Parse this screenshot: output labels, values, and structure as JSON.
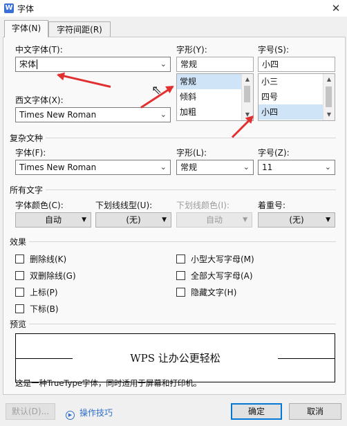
{
  "window": {
    "title": "字体",
    "app_icon": "W",
    "close": "✕"
  },
  "tabs": [
    {
      "label": "字体(N)",
      "active": true
    },
    {
      "label": "字符间距(R)",
      "active": false
    }
  ],
  "chinese_font": {
    "label": "中文字体(T):",
    "value": "宋体"
  },
  "style": {
    "label": "字形(Y):",
    "value": "常规",
    "options": [
      "常规",
      "倾斜",
      "加粗"
    ],
    "selected": "常规"
  },
  "size": {
    "label": "字号(S):",
    "value": "小四",
    "options": [
      "小三",
      "四号",
      "小四"
    ],
    "selected": "小四"
  },
  "western_font": {
    "label": "西文字体(X):",
    "value": "Times New Roman"
  },
  "complex_script": {
    "section": "复杂文种",
    "font_label": "字体(F):",
    "font_value": "Times New Roman",
    "style_label": "字形(L):",
    "style_value": "常规",
    "size_label": "字号(Z):",
    "size_value": "11"
  },
  "all_text": {
    "section": "所有文字",
    "font_color_label": "字体颜色(C):",
    "font_color_value": "自动",
    "underline_type_label": "下划线线型(U):",
    "underline_type_value": "(无)",
    "underline_color_label": "下划线颜色(I):",
    "underline_color_value": "自动",
    "emphasis_label": "着重号:",
    "emphasis_value": "(无)"
  },
  "effects": {
    "section": "效果",
    "left": [
      "删除线(K)",
      "双删除线(G)",
      "上标(P)",
      "下标(B)"
    ],
    "right": [
      "小型大写字母(M)",
      "全部大写字母(A)",
      "隐藏文字(H)"
    ]
  },
  "preview": {
    "section": "预览",
    "sample": "WPS 让办公更轻松",
    "note": "这是一种TrueType字体，同时适用于屏幕和打印机。"
  },
  "buttons": {
    "default": "默认(D)...",
    "tips": "操作技巧",
    "ok": "确定",
    "cancel": "取消"
  },
  "colors": {
    "annotation_arrow": "#e03030",
    "selection": "#cfe4f7",
    "focus": "#0078d7"
  }
}
